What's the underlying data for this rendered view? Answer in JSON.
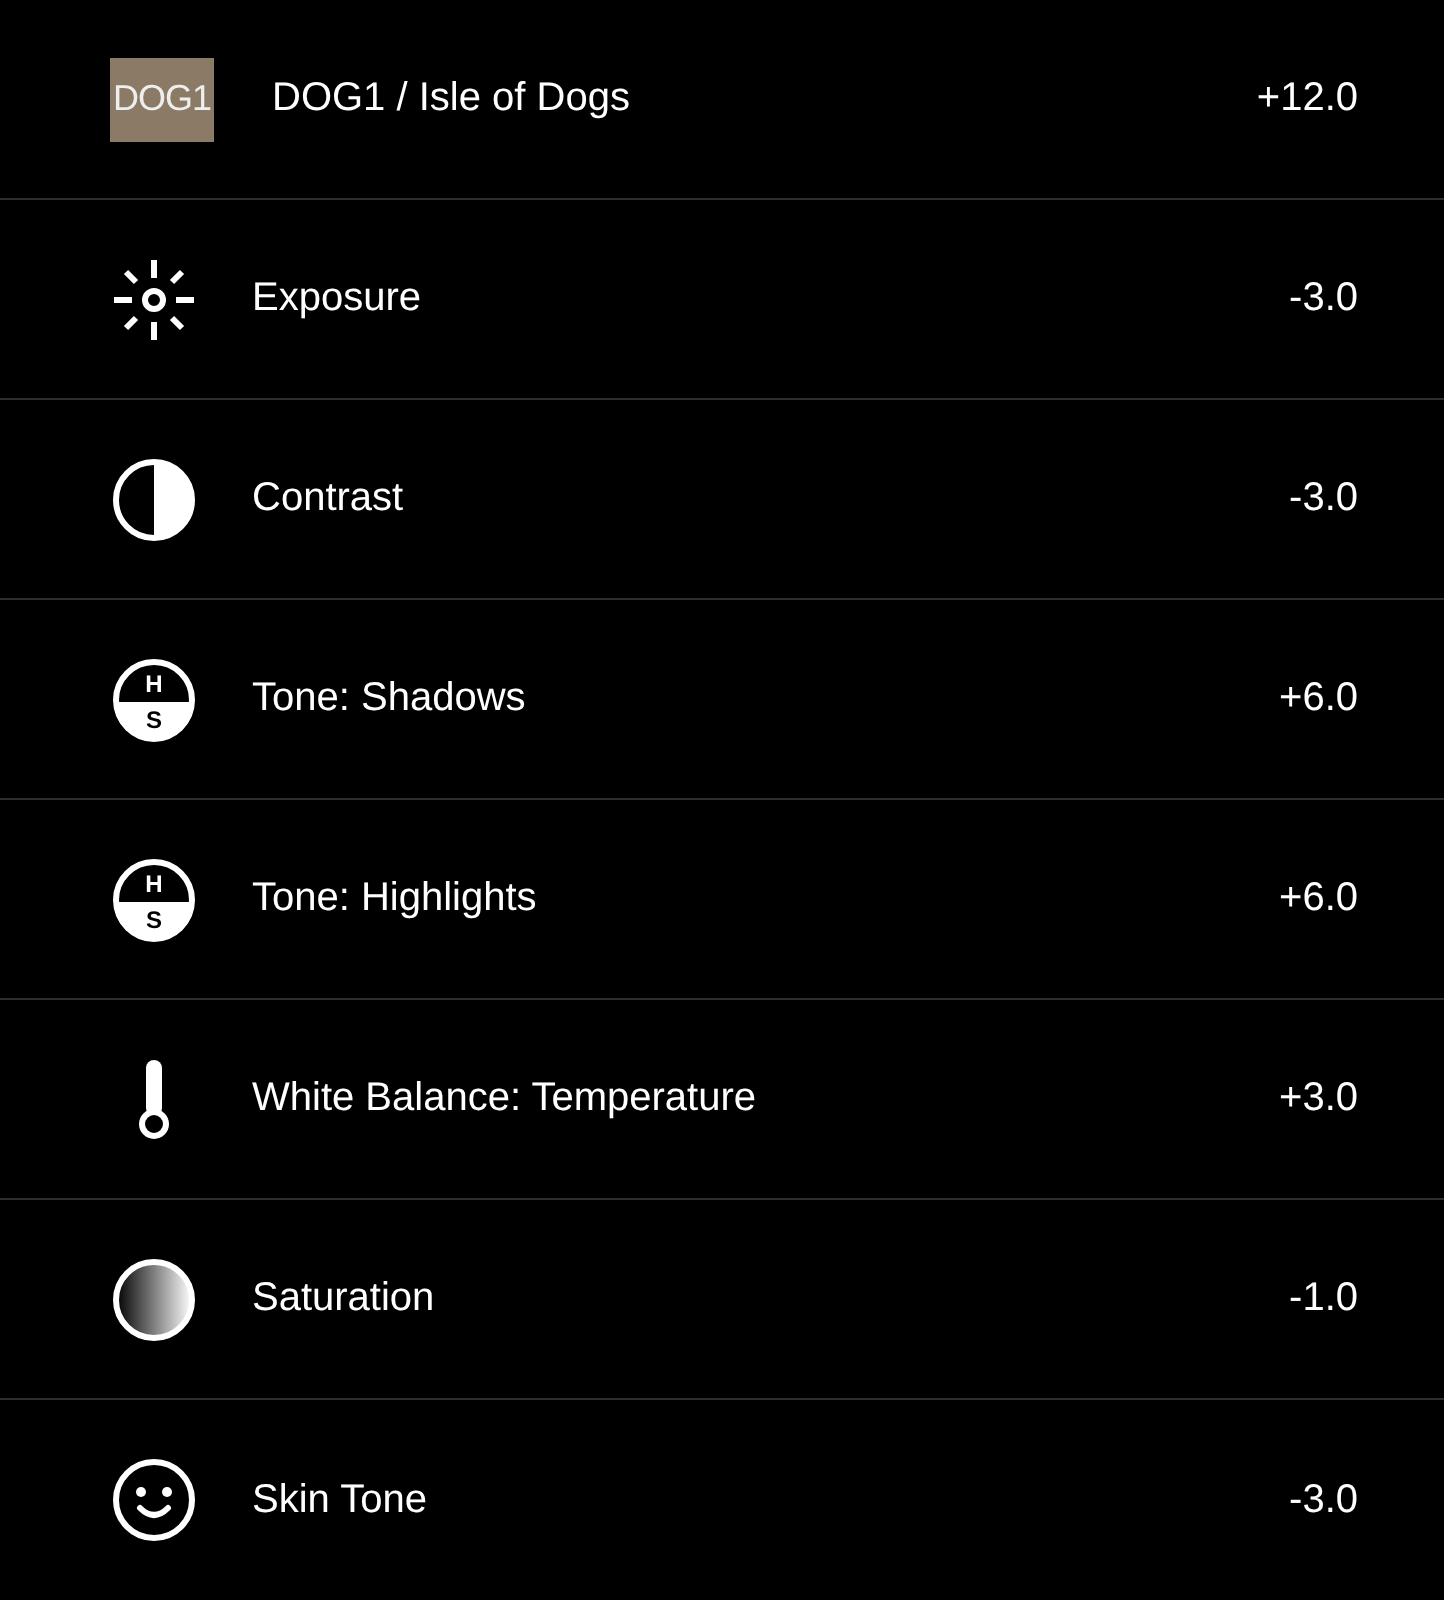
{
  "rows": [
    {
      "kind": "preset",
      "swatch": {
        "text": "DOG1",
        "color": "#8b7a66"
      },
      "label": "DOG1 / Isle of Dogs",
      "value": "+12.0"
    },
    {
      "kind": "exposure",
      "label": "Exposure",
      "value": "-3.0"
    },
    {
      "kind": "contrast",
      "label": "Contrast",
      "value": "-3.0"
    },
    {
      "kind": "tone",
      "icon_letters": [
        "H",
        "S"
      ],
      "label": "Tone: Shadows",
      "value": "+6.0"
    },
    {
      "kind": "tone",
      "icon_letters": [
        "H",
        "S"
      ],
      "label": "Tone: Highlights",
      "value": "+6.0"
    },
    {
      "kind": "temperature",
      "label": "White Balance: Temperature",
      "value": "+3.0"
    },
    {
      "kind": "saturation",
      "label": "Saturation",
      "value": "-1.0"
    },
    {
      "kind": "skin",
      "label": "Skin Tone",
      "value": "-3.0"
    }
  ]
}
